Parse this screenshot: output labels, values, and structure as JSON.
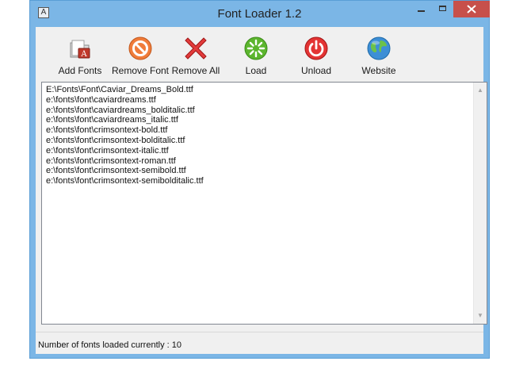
{
  "window": {
    "title": "Font Loader 1.2",
    "app_icon_glyph": "A"
  },
  "toolbar": {
    "buttons": [
      {
        "label": "Add Fonts",
        "icon": "add-fonts-icon"
      },
      {
        "label": "Remove Font",
        "icon": "remove-font-icon"
      },
      {
        "label": "Remove All",
        "icon": "remove-all-icon"
      },
      {
        "label": "Load",
        "icon": "load-icon"
      },
      {
        "label": "Unload",
        "icon": "unload-icon"
      },
      {
        "label": "Website",
        "icon": "website-icon"
      }
    ]
  },
  "files": [
    "E:\\Fonts\\Font\\Caviar_Dreams_Bold.ttf",
    "e:\\fonts\\font\\caviardreams.ttf",
    "e:\\fonts\\font\\caviardreams_bolditalic.ttf",
    "e:\\fonts\\font\\caviardreams_italic.ttf",
    "e:\\fonts\\font\\crimsontext-bold.ttf",
    "e:\\fonts\\font\\crimsontext-bolditalic.ttf",
    "e:\\fonts\\font\\crimsontext-italic.ttf",
    "e:\\fonts\\font\\crimsontext-roman.ttf",
    "e:\\fonts\\font\\crimsontext-semibold.ttf",
    "e:\\fonts\\font\\crimsontext-semibolditalic.ttf"
  ],
  "status": {
    "text": "Number of fonts loaded currently : 10"
  },
  "colors": {
    "frame": "#7bb6e6",
    "close_button": "#c7504b",
    "client_bg": "#f0f0f0"
  }
}
